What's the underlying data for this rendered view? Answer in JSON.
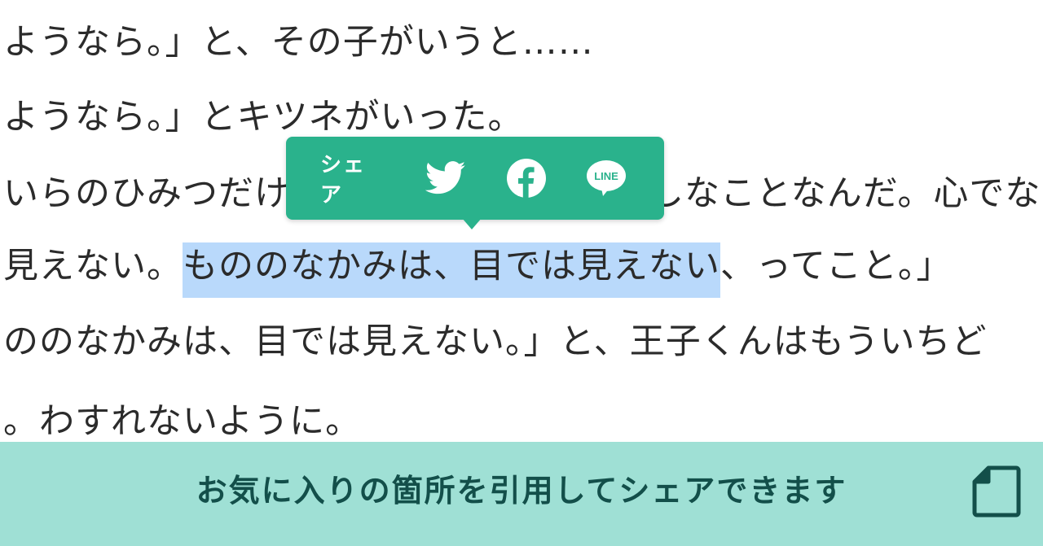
{
  "article": {
    "lines": [
      "ようなら。」と、その子がいうと……",
      "ようなら。」とキツネがいった。",
      "いらのひみつだけ",
      "見えない。",
      "ののなかみは、目では見えない。」と、王子くんはもういちど",
      "。わすれないように。"
    ],
    "line3_tail": "しなことなんだ。心でな",
    "line4_highlight": "もののなかみは、目では見えない",
    "line4_tail": "、ってこと。」"
  },
  "share_popover": {
    "label": "シェア",
    "twitter_icon": "twitter-icon",
    "facebook_icon": "facebook-icon",
    "line_icon": "line-icon",
    "line_text": "LINE",
    "color": "#2ab28c"
  },
  "bottom_bar": {
    "message": "お気に入りの箇所を引用してシェアできます",
    "icon": "note-icon",
    "background": "#9fe0d5",
    "text_color": "#134f4a"
  }
}
